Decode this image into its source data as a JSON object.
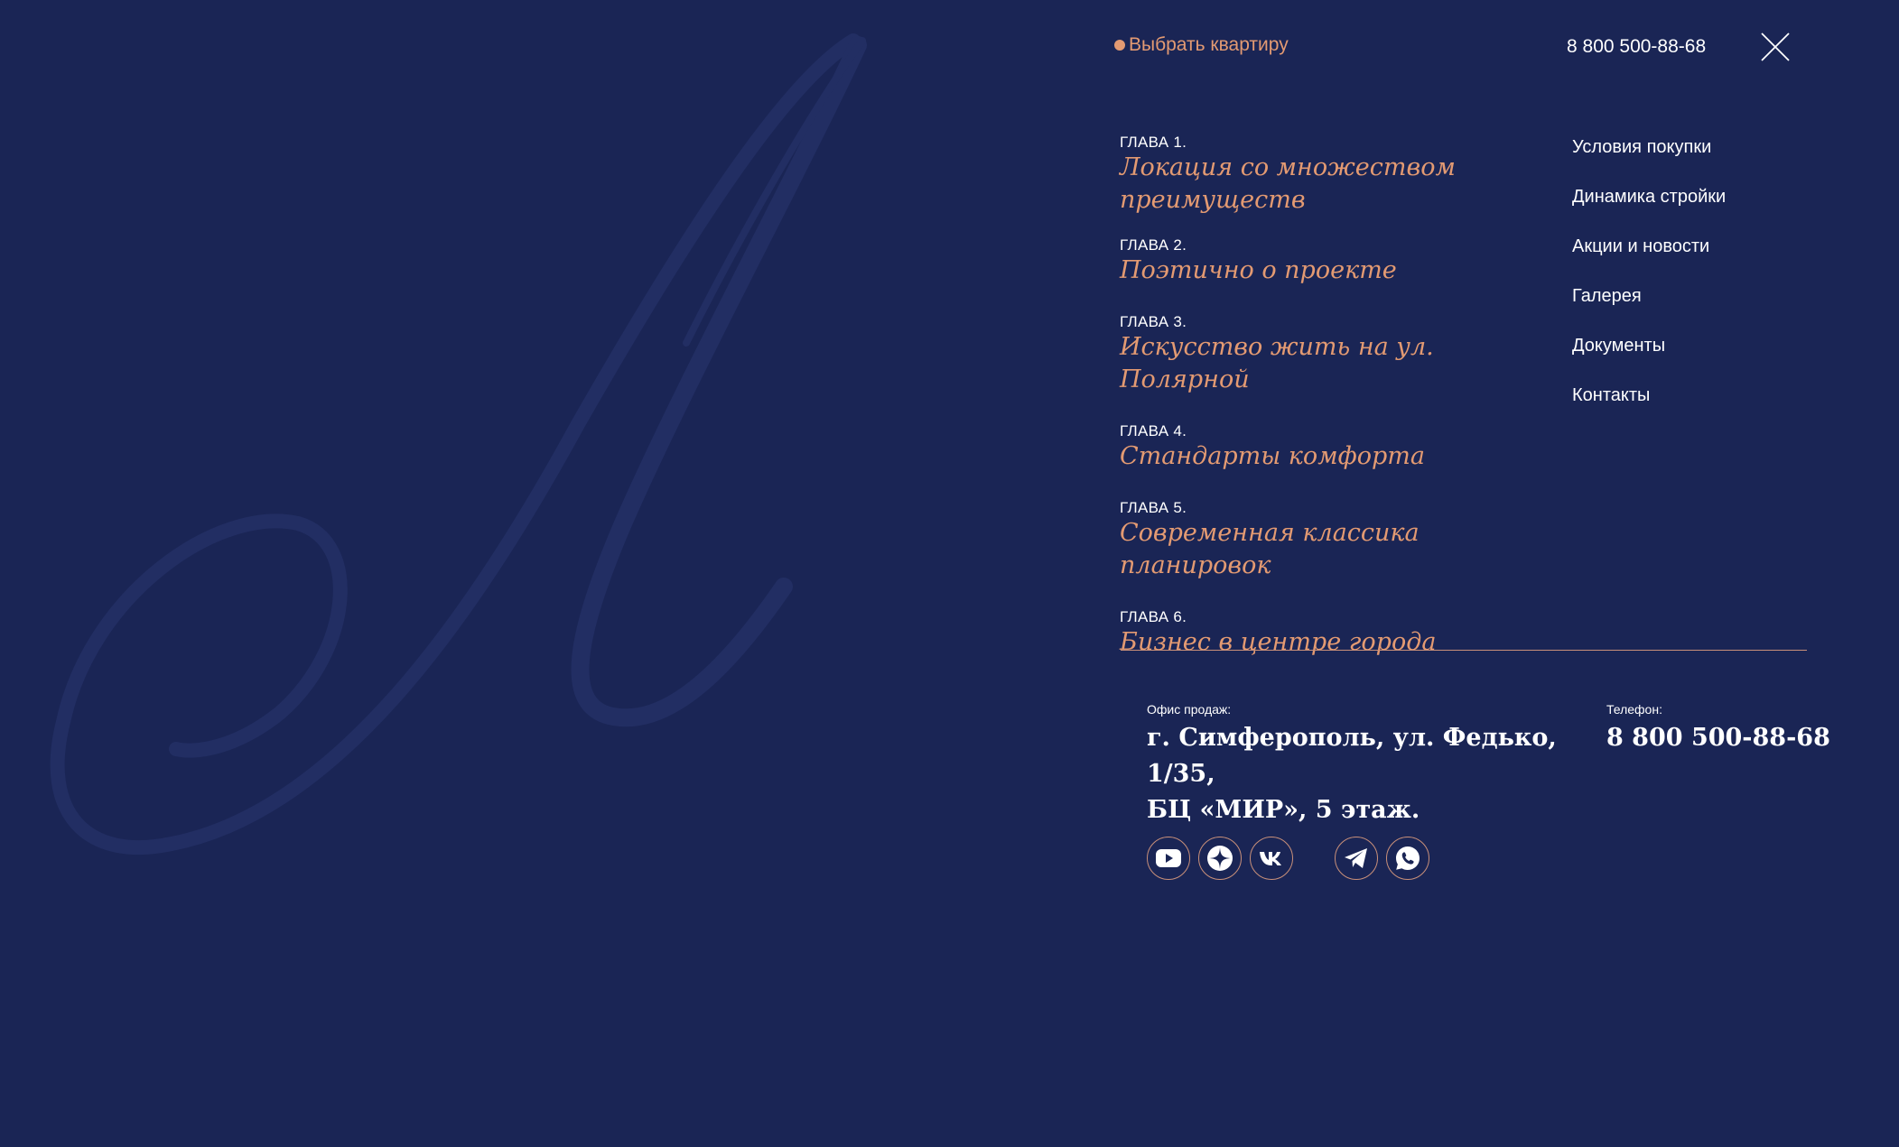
{
  "header": {
    "choose_apartment": "Выбрать квартиру",
    "phone": "8 800 500-88-68",
    "close_icon": "close-icon"
  },
  "chapters": [
    {
      "number": "ГЛАВА 1.",
      "title_line1": "Локация со множеством",
      "title_line2": "преимуществ"
    },
    {
      "number": "ГЛАВА 2.",
      "title_line1": "Поэтично о проекте"
    },
    {
      "number": "ГЛАВА 3.",
      "title_line1": "Искусство жить на ул. Полярной"
    },
    {
      "number": "ГЛАВА 4.",
      "title_line1": "Стандарты комфорта"
    },
    {
      "number": "ГЛАВА 5.",
      "title_line1": "Современная классика планировок"
    },
    {
      "number": "ГЛАВА 6.",
      "title_line1": "Бизнес в центре города"
    }
  ],
  "nav": [
    "Условия покупки",
    "Динамика стройки",
    "Акции и новости",
    "Галерея",
    "Документы",
    "Контакты"
  ],
  "office": {
    "label": "Офис продаж:",
    "address_line1": "г. Симферополь, ул. Федько, 1/35,",
    "address_line2": "БЦ «МИР», 5 этаж."
  },
  "contact": {
    "label": "Телефон:",
    "phone": "8 800 500-88-68"
  },
  "social": [
    "youtube-icon",
    "dzen-icon",
    "vk-icon",
    "telegram-icon",
    "whatsapp-icon"
  ],
  "colors": {
    "background": "#1a2555",
    "accent": "#e39a72",
    "text": "#ffffff"
  }
}
